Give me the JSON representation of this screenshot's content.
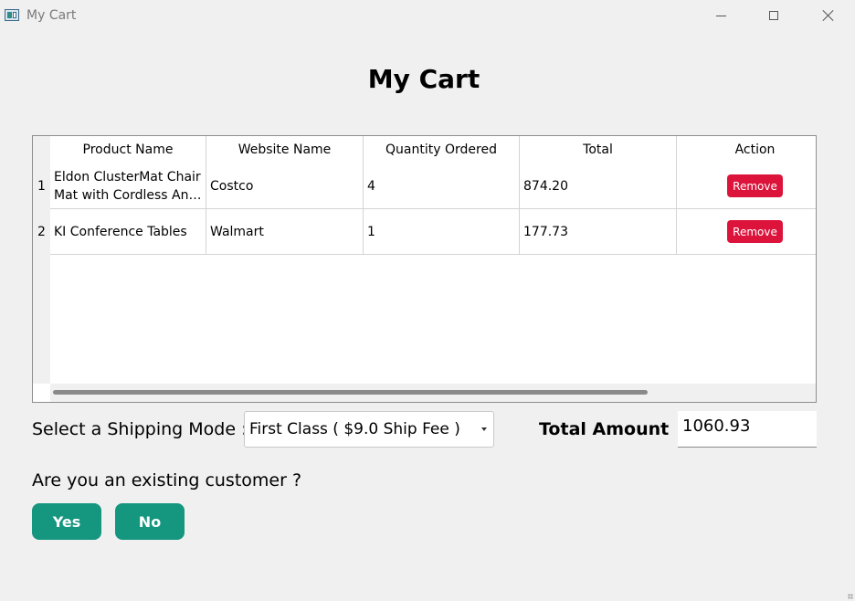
{
  "window": {
    "title": "My Cart",
    "icon": "app-window-icon",
    "controls": [
      "minimize-icon",
      "maximize-icon",
      "close-icon"
    ]
  },
  "page": {
    "title": "My Cart"
  },
  "table": {
    "columns": [
      "Product Name",
      "Website Name",
      "Quantity Ordered",
      "Total",
      "Action"
    ],
    "rows": [
      {
        "index": "1",
        "product_lines": [
          "Eldon ClusterMat Chair",
          "Mat with Cordless Anti…"
        ],
        "website": "Costco",
        "quantity": "4",
        "total": "874.20",
        "action": "Remove"
      },
      {
        "index": "2",
        "product_lines": [
          "KI Conference Tables"
        ],
        "website": "Walmart",
        "quantity": "1",
        "total": "177.73",
        "action": "Remove"
      }
    ]
  },
  "shipping": {
    "label": "Select a Shipping Mode :",
    "selected": "First Class ( $9.0 Ship Fee )"
  },
  "total": {
    "label": "Total Amount",
    "value": "1060.93"
  },
  "customer": {
    "question": "Are you an existing customer ?",
    "yes_label": "Yes",
    "no_label": "No"
  },
  "colors": {
    "remove_button": "#dc143c",
    "choice_button": "#14967f",
    "background": "#f0f0f0"
  }
}
